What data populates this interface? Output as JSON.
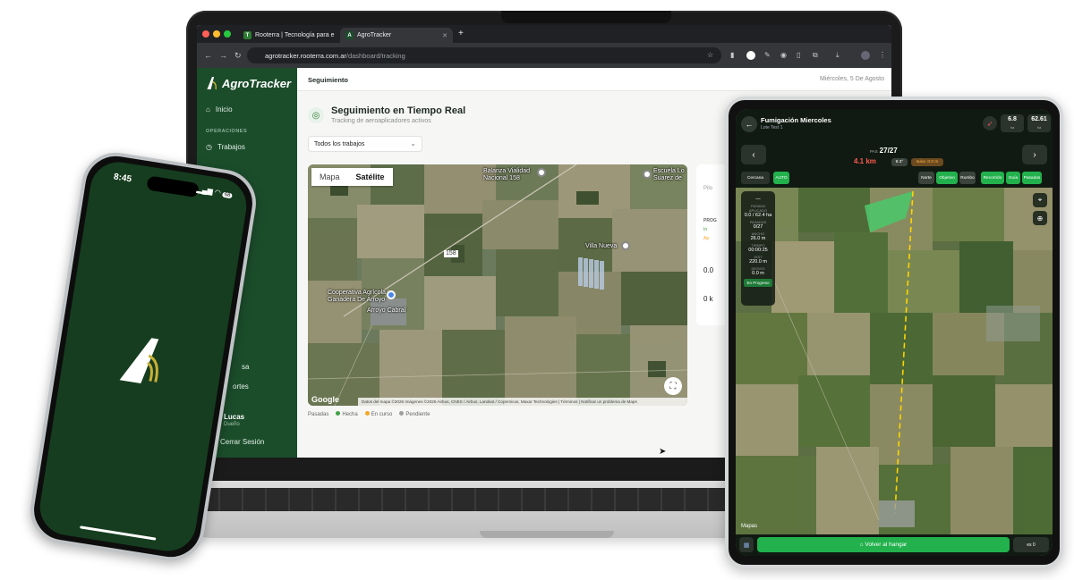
{
  "browser": {
    "tabs": [
      {
        "label": "Rooterra | Tecnología para e",
        "favicon": "T"
      },
      {
        "label": "AgroTracker",
        "favicon": "A"
      }
    ],
    "url_host": "agrotracker.rooterra.com.ar",
    "url_path": "/dashboard/tracking"
  },
  "sidebar": {
    "brand": "AgroTracker",
    "items": [
      {
        "label": "Inicio",
        "icon": "home-icon"
      },
      {
        "label": "Trabajos",
        "icon": "clock-icon"
      }
    ],
    "section_label": "OPERACIONES",
    "partial_items": [
      "sa",
      "ortes"
    ],
    "user_name": "Lucas",
    "user_role": "Dueño",
    "logout": "Cerrar Sesión"
  },
  "header": {
    "crumb": "Seguimiento",
    "date": "Miércoles, 5 De Agosto"
  },
  "page": {
    "title": "Seguimiento en Tiempo Real",
    "subtitle": "Tracking de aeroaplicadores activos",
    "filter_value": "Todos los trabajos"
  },
  "map": {
    "toggle": [
      "Mapa",
      "Satélite"
    ],
    "selected": "Satélite",
    "labels": {
      "balanza": "Balanza Vialidad\nNacional 158",
      "escuela": "Escuela Lo\nSuarez de",
      "villa_nueva": "Villa Nueva",
      "cooperativa": "Cooperativa Agrícola\nGanadera De Arroyo",
      "arroyo": "Arroyo Cabral",
      "route_158": "158"
    },
    "google": "Google",
    "attribution": "Datos del mapa ©2026 Imágenes ©2026 Airbus, CNES / Airbus, Landsat / Copernicus, Maxar Technologies | Términos | Notificar un problema de Maps",
    "legend_title": "Pasadas",
    "legend": [
      {
        "label": "Hecha",
        "color": "#43a047"
      },
      {
        "label": "En curso",
        "color": "#f5a623"
      },
      {
        "label": "Pendiente",
        "color": "#9e9e9e"
      }
    ],
    "side_partial": [
      "Pilo",
      "PROG",
      "In",
      "Ap",
      "0.0",
      "0 k"
    ]
  },
  "phone": {
    "time": "8:45",
    "status": "68"
  },
  "tablet": {
    "title": "Fumigación Miercoles",
    "subtitle": "Lote Test 1",
    "stat1": {
      "value": "6.8",
      "unit": "ha"
    },
    "stat2": {
      "value": "62.61",
      "unit": "ha"
    },
    "pasada_label": "PAS",
    "pasada": "27/27",
    "distance": "4.1 km",
    "chips_mid": [
      "8.3°",
      "Iaixa: 0.0 m"
    ],
    "left_modes": [
      "Cercana",
      "AUTO"
    ],
    "right_modes": [
      "Norte",
      "Objetivo",
      "Rumbo",
      "Recorrido",
      "Guía",
      "Pasadas"
    ],
    "panel": [
      {
        "label": "PASADA",
        "value": "—"
      },
      {
        "label": "APLICADO",
        "value": "0.0 / 62.4 ha"
      },
      {
        "label": "PASADAS",
        "value": "0/27"
      },
      {
        "label": "ANCHO",
        "value": "26.0 m"
      },
      {
        "label": "TIEMPO",
        "value": "00:00:25"
      },
      {
        "label": "DIST",
        "value": "220.0 m"
      },
      {
        "label": "DESVÍO",
        "value": "0.0 m"
      }
    ],
    "panel_status": "En Progreso",
    "maps_brand": "Mapas",
    "return_button": "Volver al hangar",
    "bottom_right": "es 0"
  },
  "colors": {
    "sidebar_green": "#1b4d2b",
    "accent_green": "#22b14c",
    "alert_red": "#ff5a4e",
    "guide_yellow": "#ffd400"
  }
}
